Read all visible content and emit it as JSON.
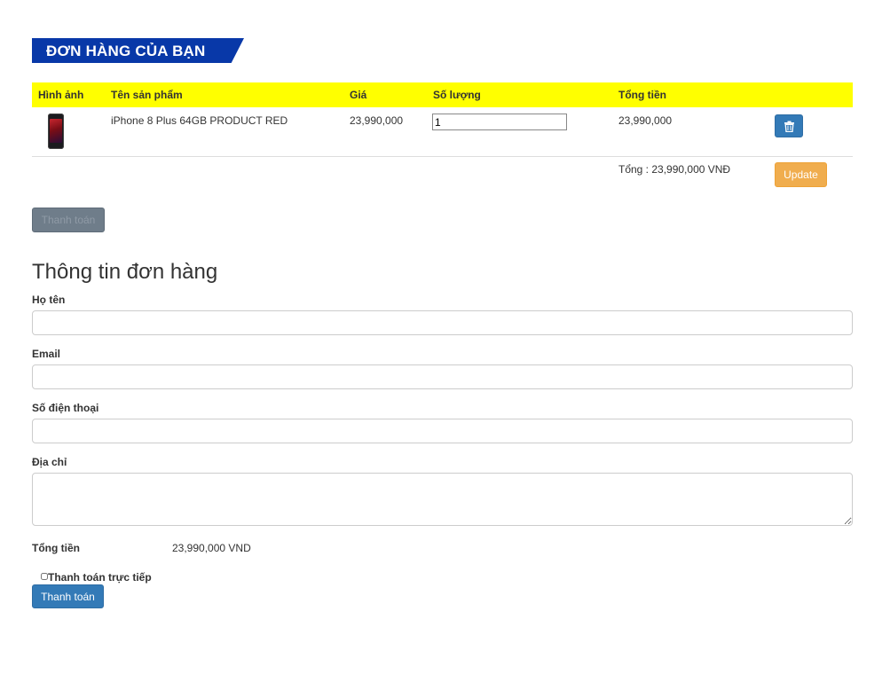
{
  "banner": {
    "title": "ĐƠN HÀNG CỦA BẠN"
  },
  "cart": {
    "headers": [
      "Hình ảnh",
      "Tên sản phẩm",
      "Giá",
      "Số lượng",
      "Tổng tiền"
    ],
    "items": [
      {
        "image_icon": "phone-image",
        "name": "iPhone 8 Plus 64GB PRODUCT RED",
        "price": "23,990,000",
        "quantity": "1",
        "line_total": "23,990,000",
        "delete_icon": "trash-icon"
      }
    ],
    "grand_total": "Tổng : 23,990,000 VNĐ",
    "update_label": "Update"
  },
  "checkout_disabled_label": "Thanh toán",
  "form": {
    "title": "Thông tin đơn hàng",
    "name_label": "Họ tên",
    "name_value": "",
    "email_label": "Email",
    "email_value": "",
    "phone_label": "Số điện thoại",
    "phone_value": "",
    "address_label": "Địa chỉ",
    "address_value": "",
    "total_label": "Tổng tiền",
    "total_value": "23,990,000 VND",
    "direct_pay_label": "Thanh toán trực tiếp",
    "direct_pay_checked": false,
    "submit_label": "Thanh toán"
  },
  "colors": {
    "banner": "#0838a8",
    "header_row": "#ffff00",
    "primary": "#337ab7",
    "warning": "#f0ad4e",
    "disabled": "#6f7d8a"
  }
}
